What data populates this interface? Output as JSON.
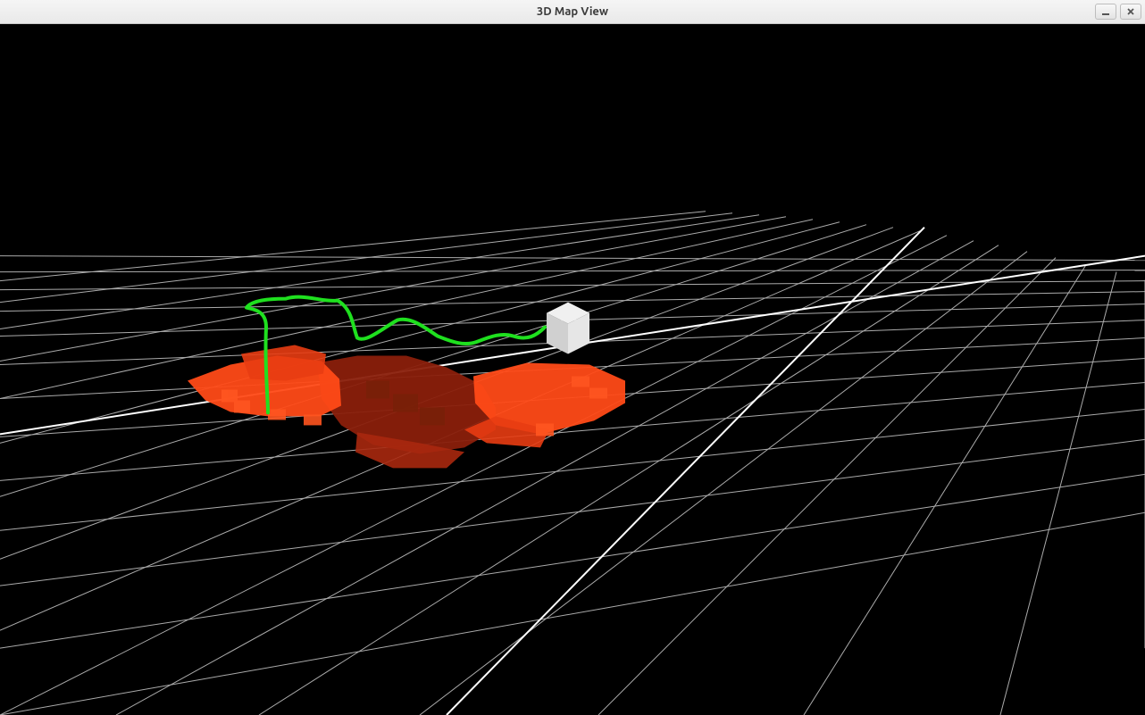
{
  "window": {
    "title": "3D Map View",
    "controls": {
      "minimize_icon": "minimize-icon",
      "close_icon": "close-icon"
    }
  },
  "scene": {
    "description": "3D SLAM map view",
    "colors": {
      "background": "#000000",
      "grid_thin": "#ababab",
      "grid_bold": "#ffffff",
      "path": "#1fe01f",
      "surface_bright": "#ff4a17",
      "surface_mid": "#cc3a18",
      "surface_dark": "#8a1f0b",
      "cube_light": "#e6e6e6",
      "cube_shade": "#d0d0d0"
    },
    "objects": {
      "grid": "perspective ground-plane grid",
      "trajectory": "green robot path polyline",
      "pointcloud": "orange/red occupied surface patches",
      "marker": "light grey cube pose marker"
    }
  }
}
